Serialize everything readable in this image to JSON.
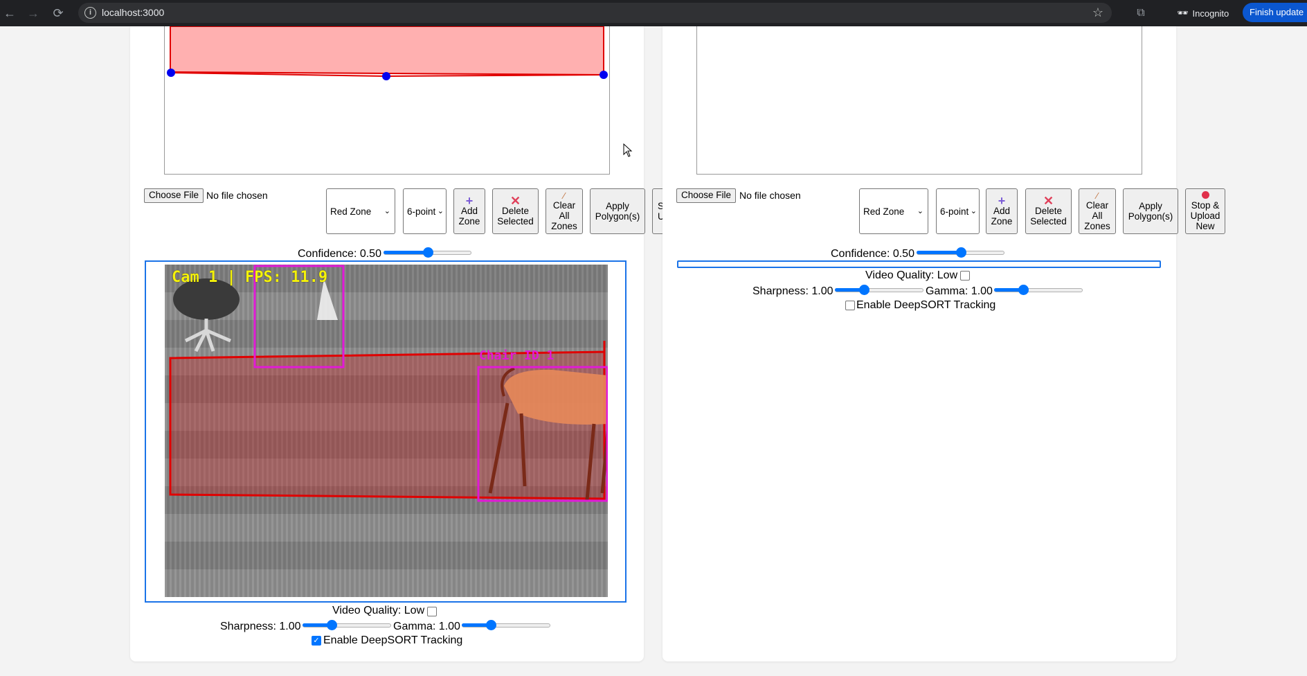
{
  "browser": {
    "url": "localhost:3000",
    "incognito_label": "Incognito",
    "finish_update_label": "Finish update"
  },
  "colors": {
    "accent": "#0075ff",
    "zone_red": "#ff0000",
    "bbox_magenta": "#e11ad6",
    "fps_yellow": "#f5f20a"
  },
  "cam1": {
    "file": {
      "button": "Choose File",
      "status": "No file chosen"
    },
    "zone_select": "Red Zone",
    "shape_select": "6-point",
    "buttons": {
      "add_zone": [
        "Add",
        "Zone"
      ],
      "delete_selected": [
        "Delete",
        "Selected"
      ],
      "clear_all": [
        "Clear",
        "All",
        "Zones"
      ],
      "apply": [
        "Apply",
        "Polygon(s)"
      ],
      "stop_upload": [
        "S",
        "U"
      ]
    },
    "confidence_label": "Confidence: 0.50",
    "confidence_value": 0.5,
    "overlay_text": "Cam 1 | FPS: 11.9",
    "detection_label": "Chair ID 1",
    "video_quality_label": "Video Quality: Low",
    "video_quality_checked": false,
    "sharpness_label": "Sharpness: 1.00",
    "sharpness_value": 0.33,
    "gamma_label": "Gamma: 1.00",
    "gamma_value": 0.33,
    "deepsort_label": "Enable DeepSORT Tracking",
    "deepsort_checked": true
  },
  "cam2": {
    "file": {
      "button": "Choose File",
      "status": "No file chosen"
    },
    "zone_select": "Red Zone",
    "shape_select": "6-point",
    "buttons": {
      "add_zone": [
        "Add",
        "Zone"
      ],
      "delete_selected": [
        "Delete",
        "Selected"
      ],
      "clear_all": [
        "Clear",
        "All",
        "Zones"
      ],
      "apply": [
        "Apply",
        "Polygon(s)"
      ],
      "stop_upload": [
        "Stop &",
        "Upload",
        "New"
      ]
    },
    "confidence_label": "Confidence: 0.50",
    "confidence_value": 0.5,
    "video_quality_label": "Video Quality: Low",
    "video_quality_checked": false,
    "sharpness_label": "Sharpness: 1.00",
    "sharpness_value": 0.33,
    "gamma_label": "Gamma: 1.00",
    "gamma_value": 0.33,
    "deepsort_label": "Enable DeepSORT Tracking",
    "deepsort_checked": false
  }
}
